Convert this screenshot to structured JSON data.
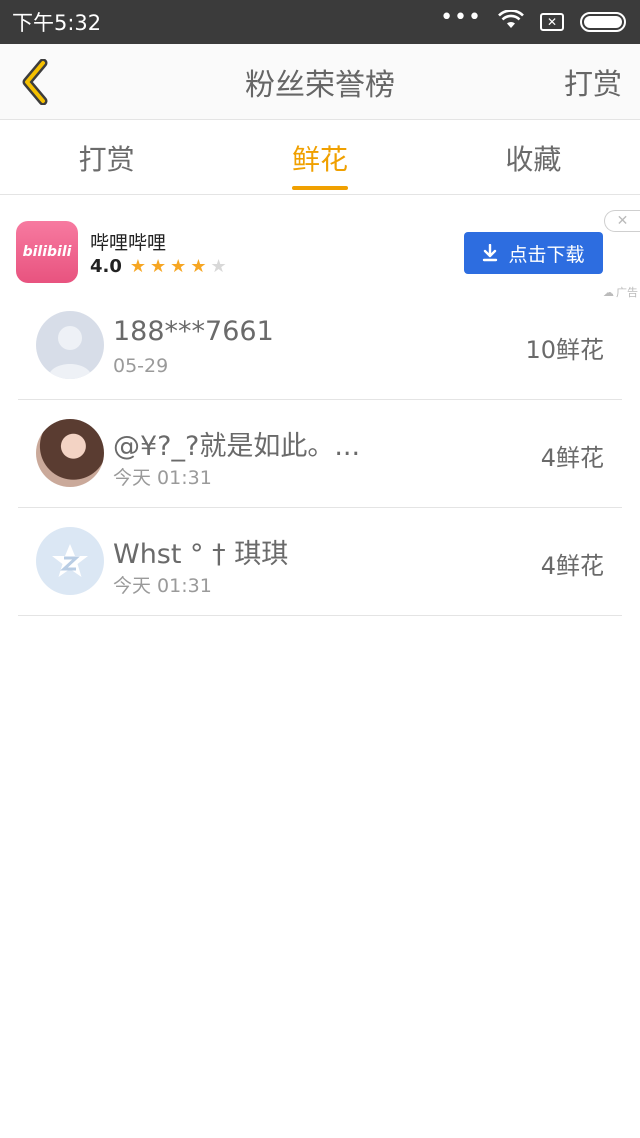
{
  "status_bar": {
    "time": "下午5:32",
    "dots": "•••",
    "icons": [
      "wifi-icon",
      "sim-icon",
      "battery-icon"
    ],
    "battery_level": 1.0
  },
  "header": {
    "title": "粉丝荣誉榜",
    "action_label": "打赏",
    "back_icon": "chevron-left-icon",
    "accent_color": "#f0a000"
  },
  "tabs": [
    {
      "label": "打赏",
      "active": false
    },
    {
      "label": "鲜花",
      "active": true
    },
    {
      "label": "收藏",
      "active": false
    }
  ],
  "ad": {
    "app_name": "哔哩哔哩",
    "icon_text": "bilibili",
    "rating": "4.0",
    "stars_filled": 4,
    "stars_total": 5,
    "download_label": "点击下载",
    "tag": "广告",
    "close_icon": "close-icon",
    "button_color": "#2d6de0"
  },
  "fans": [
    {
      "name": "188***7661",
      "time": "05-29",
      "count": "10鲜花",
      "avatar": "default-avatar"
    },
    {
      "name": "@¥?_?就是如此。...",
      "time": "今天 01:31",
      "count": "4鲜花",
      "avatar": "photo-avatar"
    },
    {
      "name": "Whst ° † 琪琪",
      "time": "今天 01:31",
      "count": "4鲜花",
      "avatar": "qq-avatar"
    }
  ]
}
